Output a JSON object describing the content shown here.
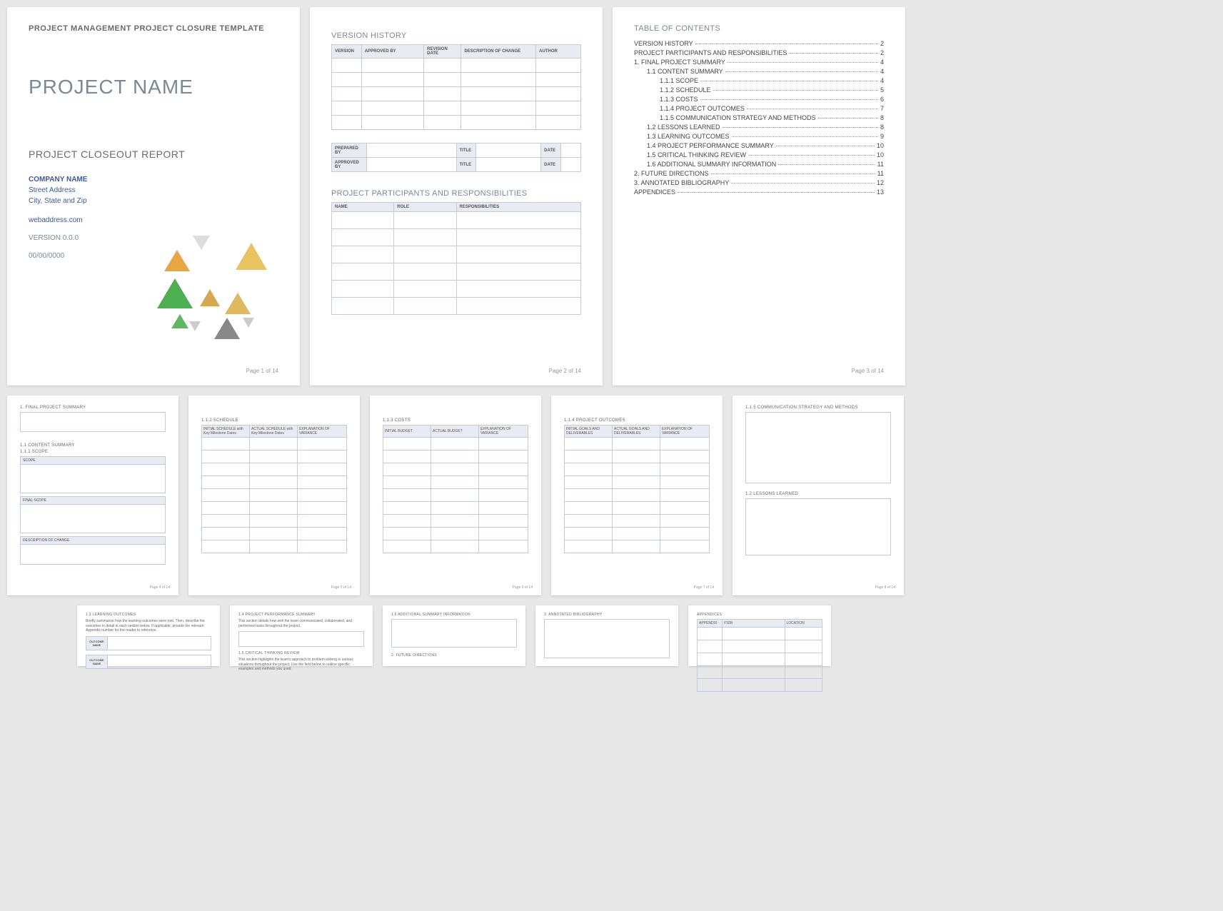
{
  "page1": {
    "template_header": "PROJECT MANAGEMENT PROJECT CLOSURE TEMPLATE",
    "project_name": "PROJECT NAME",
    "subtitle": "PROJECT CLOSEOUT REPORT",
    "company_name": "COMPANY NAME",
    "street": "Street Address",
    "city": "City, State and Zip",
    "web": "webaddress.com",
    "version": "VERSION 0.0.0",
    "date": "00/00/0000",
    "footer": "Page 1 of 14"
  },
  "page2": {
    "version_history_title": "VERSION HISTORY",
    "vh_headers": {
      "version": "VERSION",
      "approved_by": "APPROVED BY",
      "revision_date": "REVISION DATE",
      "description": "DESCRIPTION OF CHANGE",
      "author": "AUTHOR"
    },
    "prep_headers": {
      "prepared_by": "PREPARED BY",
      "title": "TITLE",
      "date": "DATE",
      "approved_by": "APPROVED BY"
    },
    "participants_title": "PROJECT PARTICIPANTS AND RESPONSIBILITIES",
    "pp_headers": {
      "name": "NAME",
      "role": "ROLE",
      "responsibilities": "RESPONSIBILITIES"
    },
    "footer": "Page 2 of 14"
  },
  "page3": {
    "toc_title": "TABLE OF CONTENTS",
    "items": [
      {
        "label": "VERSION HISTORY",
        "page": "2",
        "indent": 0
      },
      {
        "label": "PROJECT PARTICIPANTS AND RESPONSIBILITIES",
        "page": "2",
        "indent": 0
      },
      {
        "label": "1.  FINAL PROJECT SUMMARY",
        "page": "4",
        "indent": 0
      },
      {
        "label": "1.1   CONTENT SUMMARY",
        "page": "4",
        "indent": 1
      },
      {
        "label": "1.1.1  SCOPE",
        "page": "4",
        "indent": 2
      },
      {
        "label": "1.1.2  SCHEDULE",
        "page": "5",
        "indent": 2
      },
      {
        "label": "1.1.3  COSTS",
        "page": "6",
        "indent": 2
      },
      {
        "label": "1.1.4  PROJECT OUTCOMES",
        "page": "7",
        "indent": 2
      },
      {
        "label": "1.1.5  COMMUNICATION STRATEGY AND METHODS",
        "page": "8",
        "indent": 2
      },
      {
        "label": "1.2   LESSONS LEARNED",
        "page": "8",
        "indent": 1
      },
      {
        "label": "1.3   LEARNING OUTCOMES",
        "page": "9",
        "indent": 1
      },
      {
        "label": "1.4   PROJECT PERFORMANCE SUMMARY",
        "page": "10",
        "indent": 1
      },
      {
        "label": "1.5   CRITICAL THINKING REVIEW",
        "page": "10",
        "indent": 1
      },
      {
        "label": "1.6   ADDITIONAL SUMMARY INFORMATION",
        "page": "11",
        "indent": 1
      },
      {
        "label": "2.  FUTURE DIRECTIONS",
        "page": "11",
        "indent": 0
      },
      {
        "label": "3.  ANNOTATED BIBLIOGRAPHY",
        "page": "12",
        "indent": 0
      },
      {
        "label": "APPENDICES",
        "page": "13",
        "indent": 0
      }
    ],
    "footer": "Page 3 of 14"
  },
  "page4": {
    "t1": "1.  FINAL PROJECT SUMMARY",
    "t2": "1.1  CONTENT SUMMARY",
    "t3": "1.1.1  SCOPE",
    "scope_hdr": "SCOPE",
    "final_scope_hdr": "FINAL SCOPE",
    "desc_hdr": "DESCRIPTION OF CHANGE",
    "footer": "Page 4 of 14"
  },
  "page5": {
    "t1": "1.1.2  SCHEDULE",
    "h1": "INITIAL SCHEDULE with Key Milestone Dates",
    "h2": "ACTUAL SCHEDULE with Key Milestone Dates",
    "h3": "EXPLANATION OF VARIANCE",
    "footer": "Page 5 of 14"
  },
  "page6": {
    "t1": "1.1.3  COSTS",
    "h1": "INITIAL BUDGET",
    "h2": "ACTUAL BUDGET",
    "h3": "EXPLANATION OF VARIANCE",
    "footer": "Page 6 of 14"
  },
  "page7": {
    "t1": "1.1.4  PROJECT OUTCOMES",
    "h1": "INITIAL GOALS AND DELIVERABLES",
    "h2": "ACTUAL GOALS AND DELIVERABLES",
    "h3": "EXPLANATION OF VARIANCE",
    "footer": "Page 7 of 14"
  },
  "page8": {
    "t1": "1.1.5  COMMUNICATION STRATEGY AND METHODS",
    "t2": "1.2  LESSONS LEARNED",
    "footer": "Page 8 of 14"
  },
  "page9": {
    "t1": "1.3  LEARNING OUTCOMES",
    "desc": "Briefly summarize how the learning outcomes were met. Then, describe the outcomes in detail in each section below. If applicable, provide the relevant Appendix number for the reader to reference.",
    "outcome_label": "OUTCOME NAME"
  },
  "page10": {
    "t1": "1.4  PROJECT PERFORMANCE SUMMARY",
    "desc1": "This section details how well the team communicated, collaborated, and performed tasks throughout the project.",
    "t2": "1.5  CRITICAL THINKING REVIEW",
    "desc2": "This section highlights the team's approach to problem-solving in various situations throughout the project. Use the field below to outline specific examples and methods you used."
  },
  "page11": {
    "t1": "1.6  ADDITIONAL SUMMARY INFORMATION",
    "t2": "2.  FUTURE DIRECTIONS"
  },
  "page12": {
    "t1": "3.  ANNOTATED BIBLIOGRAPHY"
  },
  "page13": {
    "t1": "APPENDICES",
    "h1": "APPENDIX",
    "h2": "ITEM",
    "h3": "LOCATION"
  }
}
